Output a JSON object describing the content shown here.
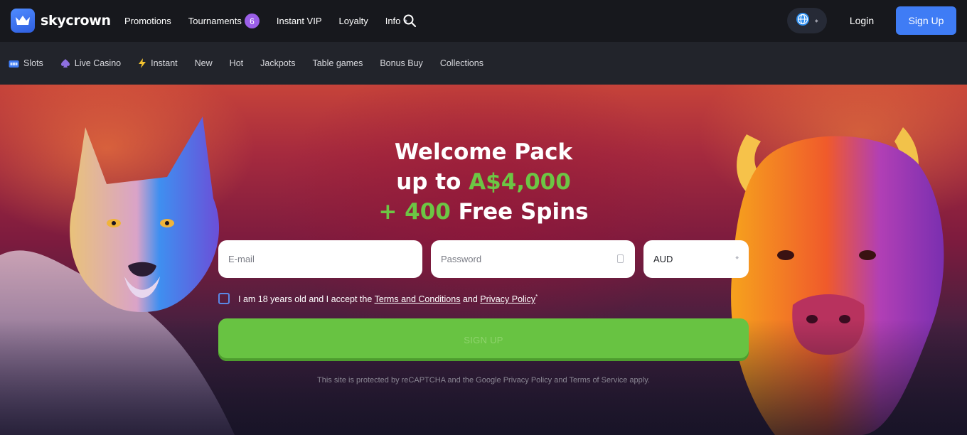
{
  "brand": {
    "name": "skycrown",
    "accent": "#3f7cf5",
    "green": "#6cc644"
  },
  "topnav": {
    "promotions": "Promotions",
    "tournaments": "Tournaments",
    "tournaments_count": "6",
    "instant_vip": "Instant VIP",
    "loyalty": "Loyalty",
    "info": "Info"
  },
  "header_actions": {
    "login": "Login",
    "signup": "Sign Up"
  },
  "categories": {
    "slots": "Slots",
    "live_casino": "Live Casino",
    "instant": "Instant",
    "new": "New",
    "hot": "Hot",
    "jackpots": "Jackpots",
    "table_games": "Table games",
    "bonus_buy": "Bonus Buy",
    "collections": "Collections"
  },
  "hero": {
    "line1": "Welcome Pack",
    "line2_prefix": "up to ",
    "line2_amount": "A$4,000",
    "line3_amount": "+ 400",
    "line3_suffix": " Free Spins"
  },
  "form": {
    "email_placeholder": "E-mail",
    "password_placeholder": "Password",
    "currency": "AUD",
    "consent_prefix": "I am 18 years old and I accept the ",
    "terms_link": "Terms and Conditions",
    "consent_and": " and ",
    "privacy_link": "Privacy Policy",
    "required_mark": "*",
    "submit": "SIGN UP",
    "recaptcha_note": "This site is protected by reCAPTCHA and the Google Privacy Policy and Terms of Service apply."
  }
}
